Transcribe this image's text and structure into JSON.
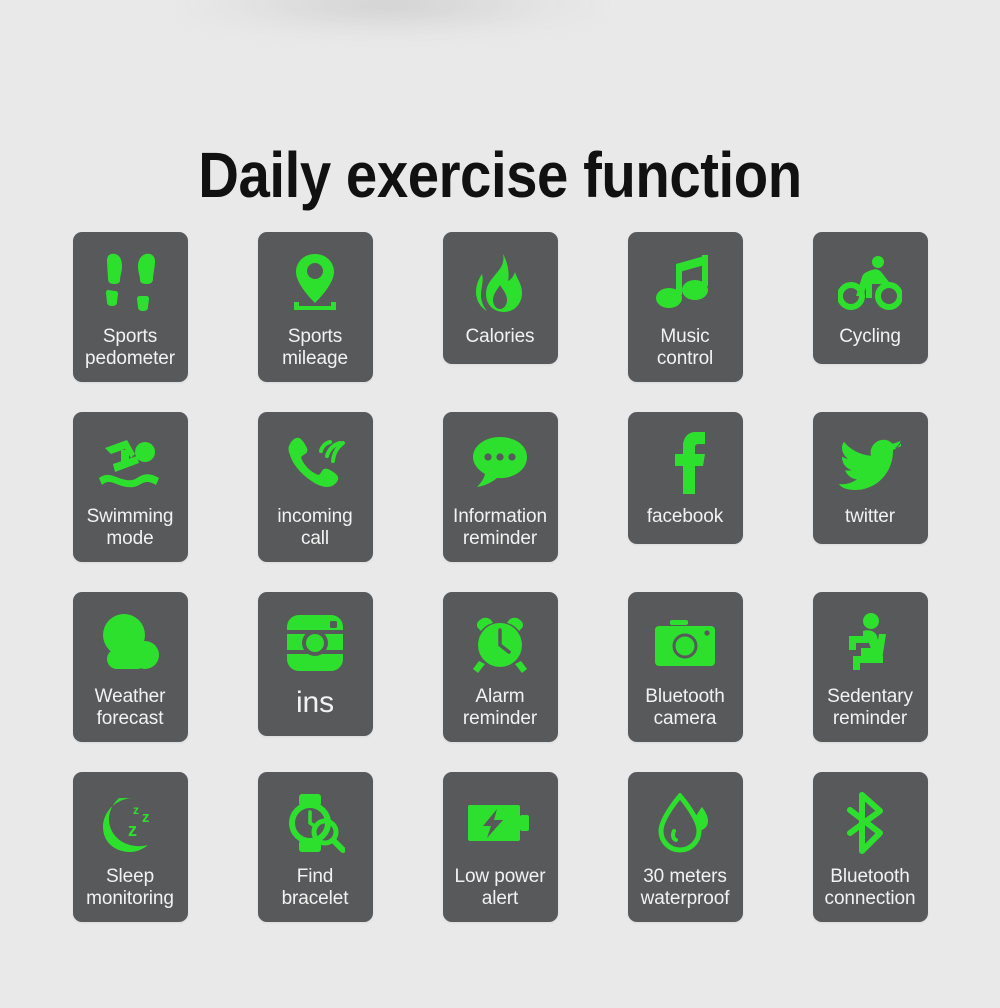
{
  "page": {
    "title": "Daily exercise function",
    "background_color": "#e9e9e9",
    "tile_color": "#58595a",
    "icon_color": "#2ee02e",
    "label_color": "#f2f2f2"
  },
  "grid": {
    "columns": 5,
    "rows": 4,
    "tiles": [
      {
        "label": "Sports\npedometer",
        "icon": "footprints-icon"
      },
      {
        "label": "Sports\nmileage",
        "icon": "map-pin-icon"
      },
      {
        "label": "Calories",
        "icon": "flame-icon"
      },
      {
        "label": "Music\ncontrol",
        "icon": "music-note-icon"
      },
      {
        "label": "Cycling",
        "icon": "cyclist-icon"
      },
      {
        "label": "Swimming\nmode",
        "icon": "swimmer-icon"
      },
      {
        "label": "incoming\ncall",
        "icon": "phone-ringing-icon"
      },
      {
        "label": "Information\nreminder",
        "icon": "chat-bubble-icon"
      },
      {
        "label": "facebook",
        "icon": "facebook-icon"
      },
      {
        "label": "twitter",
        "icon": "twitter-bird-icon"
      },
      {
        "label": "Weather\nforecast",
        "icon": "cloud-icon"
      },
      {
        "label": "ins",
        "icon": "instagram-icon"
      },
      {
        "label": "Alarm\nreminder",
        "icon": "alarm-clock-icon"
      },
      {
        "label": "Bluetooth\ncamera",
        "icon": "camera-icon"
      },
      {
        "label": "Sedentary\nreminder",
        "icon": "sitting-person-icon"
      },
      {
        "label": "Sleep\nmonitoring",
        "icon": "moon-zzz-icon"
      },
      {
        "label": "Find\nbracelet",
        "icon": "watch-search-icon"
      },
      {
        "label": "Low power\nalert",
        "icon": "battery-bolt-icon"
      },
      {
        "label": "30 meters\nwaterproof",
        "icon": "water-drop-icon"
      },
      {
        "label": "Bluetooth\nconnection",
        "icon": "bluetooth-icon"
      }
    ]
  }
}
